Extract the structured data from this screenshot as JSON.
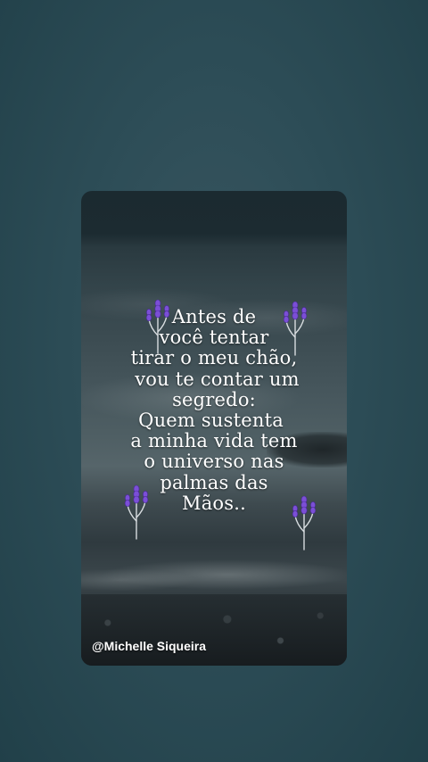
{
  "background": {
    "outer_color": "#2d4d57",
    "card_theme": "dark ocean shore at dusk"
  },
  "quote": {
    "lines": [
      "Antes de",
      "você tentar",
      "tirar o meu chão,",
      " vou te contar um",
      "segredo:",
      "Quem sustenta ",
      "a minha vida tem",
      "o universo nas",
      "palmas das",
      "Mãos.."
    ],
    "color": "#ffffff"
  },
  "watermark": "@Michelle Siqueira",
  "decorations": {
    "icon": "lavender-sprig-icon",
    "flower_color": "#7b4fd6",
    "stem_color": "#d8dde0"
  }
}
